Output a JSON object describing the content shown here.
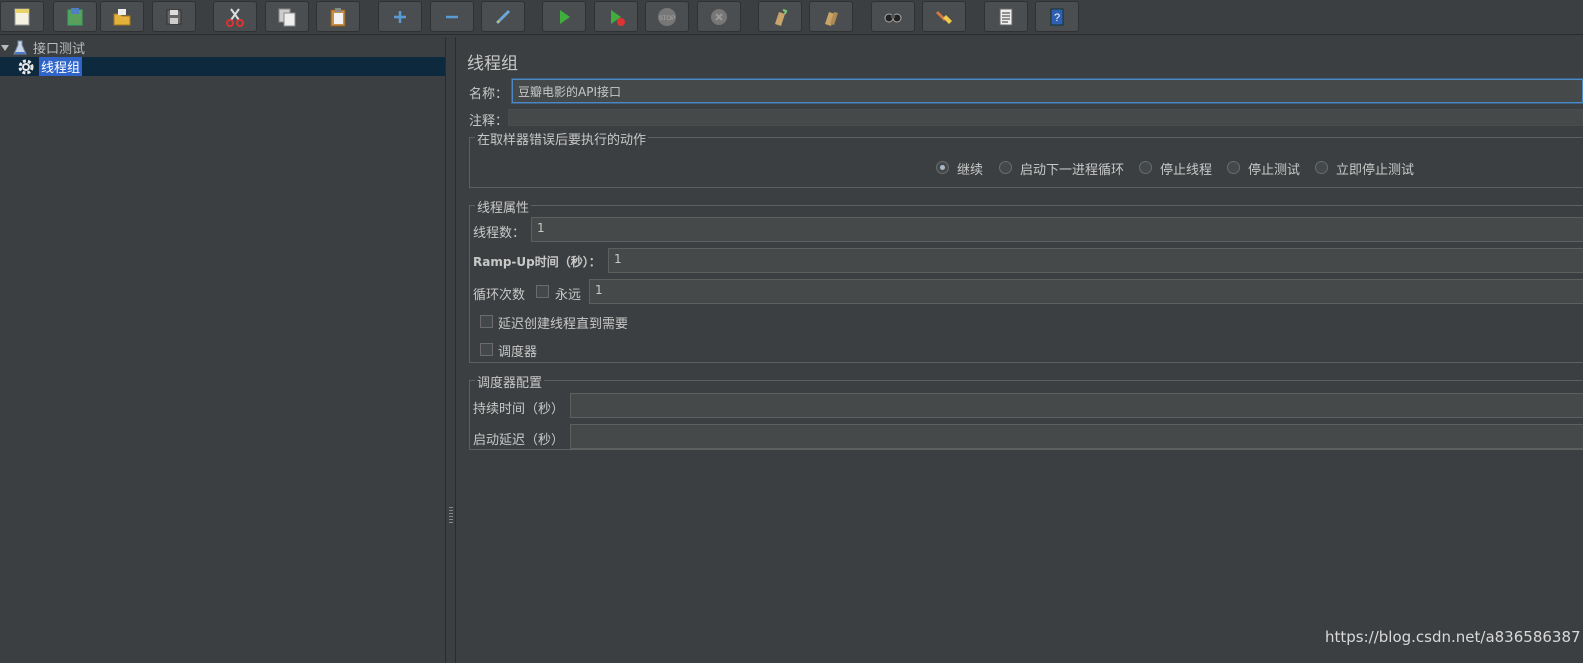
{
  "toolbar": {
    "buttons": [
      {
        "icon": "new-icon"
      },
      {
        "icon": "templates-icon"
      },
      {
        "icon": "open-icon"
      },
      {
        "icon": "save-icon"
      },
      {
        "icon": "cut-icon"
      },
      {
        "icon": "copy-icon"
      },
      {
        "icon": "paste-icon"
      },
      {
        "icon": "expand-icon"
      },
      {
        "icon": "collapse-icon"
      },
      {
        "icon": "toggle-icon"
      },
      {
        "icon": "start-icon"
      },
      {
        "icon": "start-no-pauses-icon"
      },
      {
        "icon": "stop-icon"
      },
      {
        "icon": "shutdown-icon"
      },
      {
        "icon": "clear-icon"
      },
      {
        "icon": "clear-all-icon"
      },
      {
        "icon": "search-icon"
      },
      {
        "icon": "reset-search-icon"
      },
      {
        "icon": "function-helper-icon"
      },
      {
        "icon": "help-icon"
      }
    ]
  },
  "tree": {
    "root_label": "接口测试",
    "child_label": "线程组"
  },
  "panel": {
    "title": "线程组",
    "name_label": "名称：",
    "name_value": "豆瓣电影的API接口",
    "comment_label": "注释：",
    "comment_value": "",
    "error_group_title": "在取样器错误后要执行的动作",
    "error_actions": [
      "继续",
      "启动下一进程循环",
      "停止线程",
      "停止测试",
      "立即停止测试"
    ],
    "error_selected": "继续",
    "thread_group_title": "线程属性",
    "threads_label": "线程数：",
    "threads_value": "1",
    "rampup_label": "Ramp-Up时间（秒）：",
    "rampup_value": "1",
    "loop_label": "循环次数",
    "forever_label": "永远",
    "loop_value": "1",
    "delay_label": "延迟创建线程直到需要",
    "scheduler_label": "调度器",
    "scheduler_group_title": "调度器配置",
    "duration_label": "持续时间（秒）",
    "duration_value": "",
    "startup_delay_label": "启动延迟（秒）",
    "startup_delay_value": ""
  },
  "watermark": "https://blog.csdn.net/a836586387"
}
